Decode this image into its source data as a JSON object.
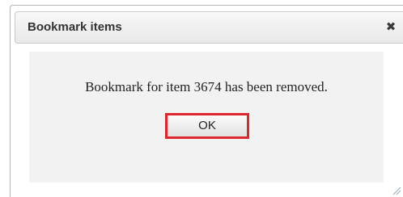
{
  "dialog": {
    "title": "Bookmark items",
    "close_icon": "close-icon",
    "close_glyph": "✖",
    "message": "Bookmark for item 3674 has been removed.",
    "ok_label": "OK",
    "ok_highlight_color": "#e0262b"
  }
}
